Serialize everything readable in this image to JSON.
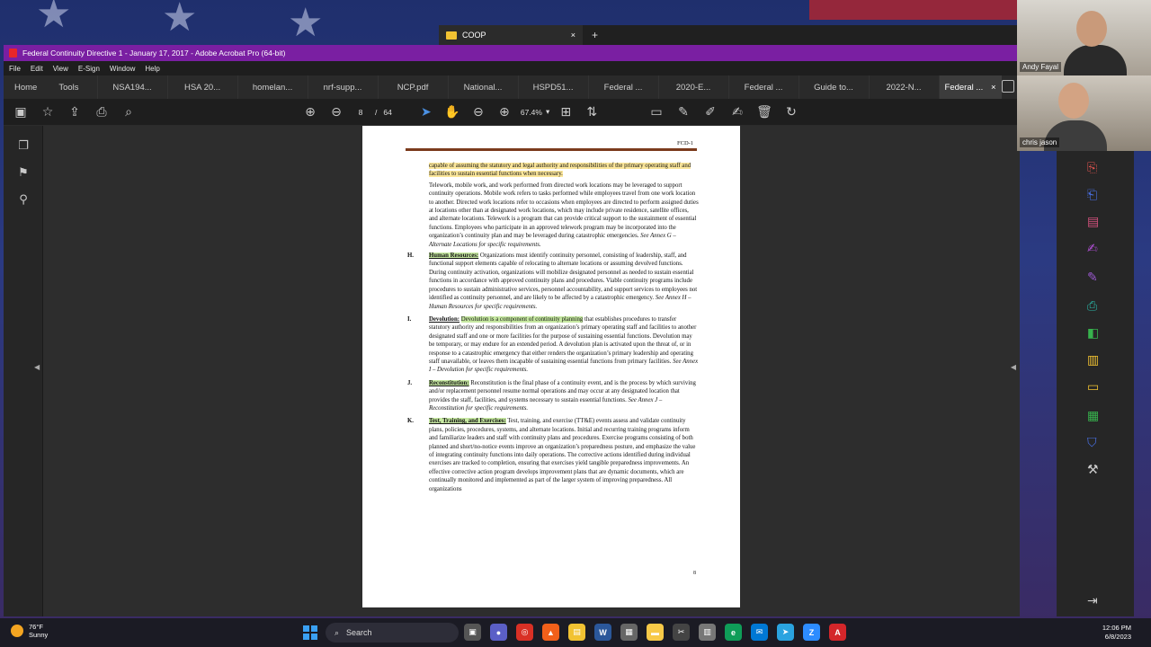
{
  "explorer": {
    "tab_title": "COOP",
    "close": "×",
    "new_tab": "+"
  },
  "window": {
    "title": "Federal Continuity Directive 1 - January 17, 2017 - Adobe Acrobat Pro (64-bit)"
  },
  "menu": [
    "File",
    "Edit",
    "View",
    "E-Sign",
    "Window",
    "Help"
  ],
  "nav": {
    "home": "Home",
    "tools": "Tools"
  },
  "doc_tabs": [
    "NSA194...",
    "HSA 20...",
    "homelan...",
    "nrf-supp...",
    "NCP.pdf",
    "National...",
    "HSPD51...",
    "Federal ...",
    "2020-E...",
    "Federal ...",
    "Guide to...",
    "2022-N..."
  ],
  "active_tab": {
    "label": "Federal ...",
    "close": "×"
  },
  "toolbar": {
    "page_current": "8",
    "page_sep": "/",
    "page_total": "64",
    "zoom": "67.4%"
  },
  "document": {
    "header_code": "FCD-1",
    "intro_hl": "capable of assuming the statutory and legal authority and responsibilities of the primary operating staff and facilities to sustain essential functions when necessary.",
    "telework": "Telework, mobile work, and work performed from directed work locations may be leveraged to support continuity operations.  Mobile work refers to tasks performed while employees travel from one work location to another.  Directed work locations refer to occasions when employees are directed to perform assigned duties at locations other than at designated work locations, which may include private residence, satellite offices, and alternate locations.  Telework is a program that can provide critical support to the sustainment of essential functions.  Employees who participate in an approved telework program may be incorporated into the organization’s continuity plan and may be leveraged during catastrophic emergencies.  ",
    "telework_ref": "See Annex G – Alternate Locations for specific requirements.",
    "sections": [
      {
        "letter": "H.",
        "head": "Human Resources:",
        "hl_text": "",
        "text": "  Organizations must identify continuity personnel, consisting of leadership, staff, and functional support elements capable of relocating to alternate locations or assuming devolved functions.  During continuity activation, organizations will mobilize designated personnel as needed to sustain essential functions in accordance with approved continuity plans and procedures.  Viable continuity programs include procedures to sustain administrative services, personnel accountability, and support services to employees not identified as continuity personnel, and are likely to be affected by a catastrophic emergency.  ",
        "ref": "See Annex H – Human Resources for specific requirements."
      },
      {
        "letter": "I.",
        "head": "Devolution:",
        "hl_text": "Devolution is a component of continuity planning",
        "text": " that establishes procedures to transfer statutory authority and responsibilities from an organization’s primary operating staff and facilities to another designated staff and one or more facilities for the purpose of sustaining essential functions.  Devolution may be temporary, or may endure for an extended period.  A devolution plan is activated upon the threat of, or in response to a catastrophic emergency that either renders the organization’s primary leadership and operating staff unavailable, or leaves them incapable of sustaining essential functions from primary facilities.  ",
        "ref": "See Annex I – Devolution for specific requirements."
      },
      {
        "letter": "J.",
        "head": "Reconstitution:",
        "hl_text": "",
        "text": "  Reconstitution is the final phase of a continuity event, and is the process by which surviving and/or replacement personnel resume normal operations and may occur at any designated location that provides the staff, facilities, and systems necessary to sustain essential functions.  ",
        "ref": "See Annex J – Reconstitution for specific requirements."
      },
      {
        "letter": "K.",
        "head": "Test, Training, and Exercises:",
        "hl_text": "",
        "text": "  Test, training, and exercise (TT&E) events assess and validate continuity plans, policies, procedures, systems, and alternate locations.  Initial and recurring training programs inform and familiarize leaders and staff with continuity plans and procedures.  Exercise programs consisting of both planned and short/no-notice events improve an organization’s preparedness posture, and emphasize the value of integrating continuity functions into daily operations.  The corrective actions identified during individual exercises are tracked to completion, ensuring that exercises yield tangible preparedness improvements.  An effective corrective action program develops improvement plans that are dynamic documents, which are continually monitored and implemented as part of the larger system of improving preparedness.  All organizations",
        "ref": ""
      }
    ],
    "page_number": "8"
  },
  "webcams": [
    {
      "name": "Andy Fayal"
    },
    {
      "name": "chris jason"
    }
  ],
  "taskbar": {
    "temp": "76°F",
    "weather": "Sunny",
    "search_placeholder": "Search",
    "time": "12:06 PM",
    "date": "6/8/2023"
  },
  "colors": {
    "title_bar": "#7a1fa2",
    "highlight_yellow": "#fbe69a",
    "highlight_green": "#c7e9a2",
    "accent_blue": "#4a90e2"
  }
}
